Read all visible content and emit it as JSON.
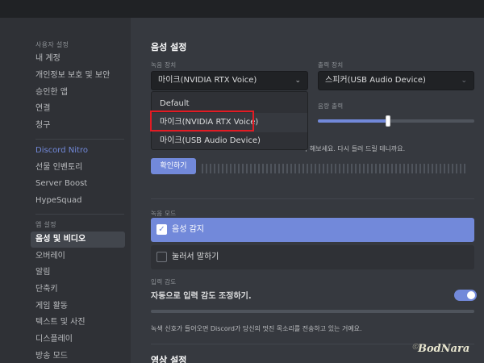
{
  "sidebar": {
    "section_user": "사용자 설정",
    "user_items": [
      "내 계정",
      "개인정보 보호 및 보안",
      "승인한 앱",
      "연결",
      "청구"
    ],
    "nitro_label": "Discord Nitro",
    "nitro_items": [
      "선물 인벤토리",
      "Server Boost",
      "HypeSquad"
    ],
    "section_app": "앱 설정",
    "app_items": [
      "음성 및 비디오",
      "오버레이",
      "알림",
      "단축키",
      "게임 활동",
      "텍스트 및 사진",
      "디스플레이",
      "방송 모드"
    ]
  },
  "main": {
    "voice_title": "음성 설정",
    "input_device_label": "녹음 장치",
    "input_device_value": "마이크(NVIDIA RTX Voice)",
    "output_device_label": "출력 장치",
    "output_device_value": "스피커(USB Audio Device)",
    "dropdown_options": [
      "Default",
      "마이크(NVIDIA RTX Voice)",
      "마이크(USB Audio Device)"
    ],
    "output_volume_label": "음량 출력",
    "output_volume_level": 0.45,
    "mic_test_partial": "나 해보세요. 다시 들려 드릴 테니까요.",
    "check_button": "확인하기",
    "input_mode_label": "녹음 모드",
    "mode_voice_activity": "음성 감지",
    "mode_ptt": "눌러서 말하기",
    "sensitivity_label": "입력 감도",
    "auto_sensitivity": "자동으로 입력 감도 조정하기.",
    "auto_sensitivity_on": true,
    "sensitivity_hint": "녹색 신호가 들어오면 Discord가 당신의 멋진 목소리를 전송하고 있는 거예요.",
    "video_title": "영상 설정"
  },
  "watermark": {
    "text": "BodNara",
    "sub": "ⓒ"
  },
  "colors": {
    "accent": "#7289da",
    "highlight": "#e31b23",
    "bg": "#36393f",
    "sidebar": "#2f3136"
  }
}
